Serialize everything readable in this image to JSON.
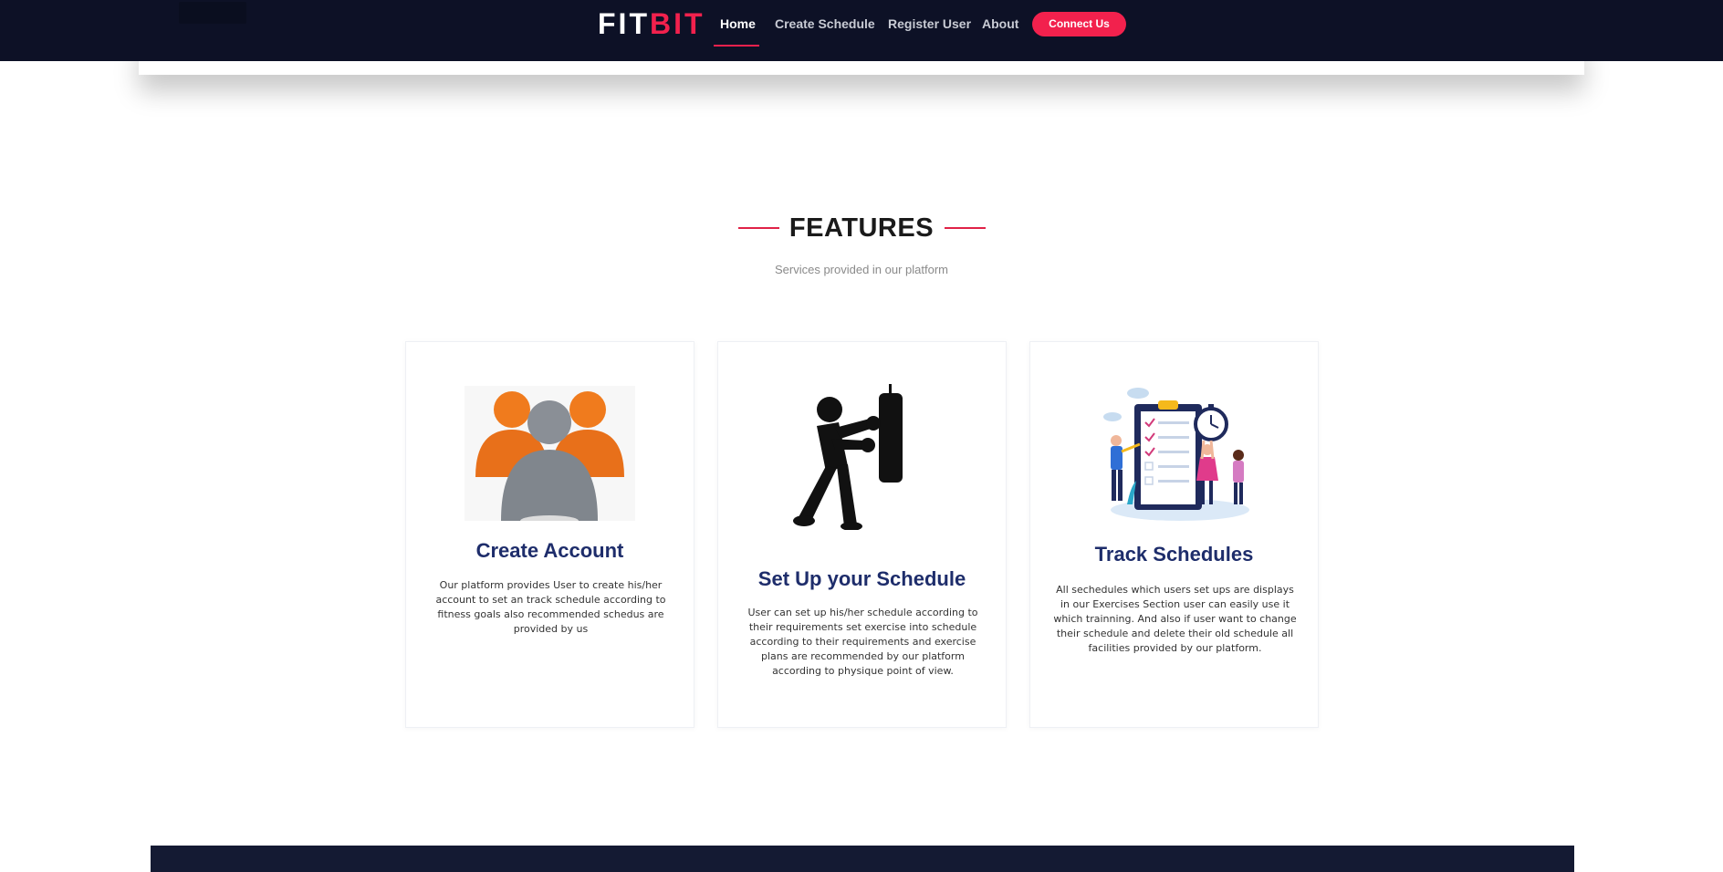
{
  "nav": {
    "logo_part1": "FIT",
    "logo_part2": "BIT",
    "links": [
      {
        "label": "Home",
        "active": true
      },
      {
        "label": "Create Schedule",
        "active": false
      },
      {
        "label": "Register User",
        "active": false
      },
      {
        "label": "About",
        "active": false
      }
    ],
    "cta_label": "Connect Us"
  },
  "features": {
    "title": "FEATURES",
    "subtitle": "Services provided in our platform",
    "cards": [
      {
        "title": "Create Account",
        "text": "Our platform provides User to create his/her account to set an track schedule according to fitness goals also recommended schedus are provided by us",
        "icon": "users-group-icon"
      },
      {
        "title": "Set Up your Schedule",
        "text": "User can set up his/her schedule according to their requirements set exercise into schedule according to their requirements and exercise plans are recommended by our platform according to physique point of view.",
        "icon": "boxer-punching-bag-icon"
      },
      {
        "title": "Track Schedules",
        "text": "All sechedules which users set ups are displays in our Exercises Section user can easily use it which trainning. And also if user want to change their schedule and delete their old schedule all facilities provided by our platform.",
        "icon": "clipboard-checklist-icon"
      }
    ]
  },
  "colors": {
    "nav_bg": "#0d1126",
    "accent": "#f2214d",
    "card_title": "#1e2d6b"
  }
}
